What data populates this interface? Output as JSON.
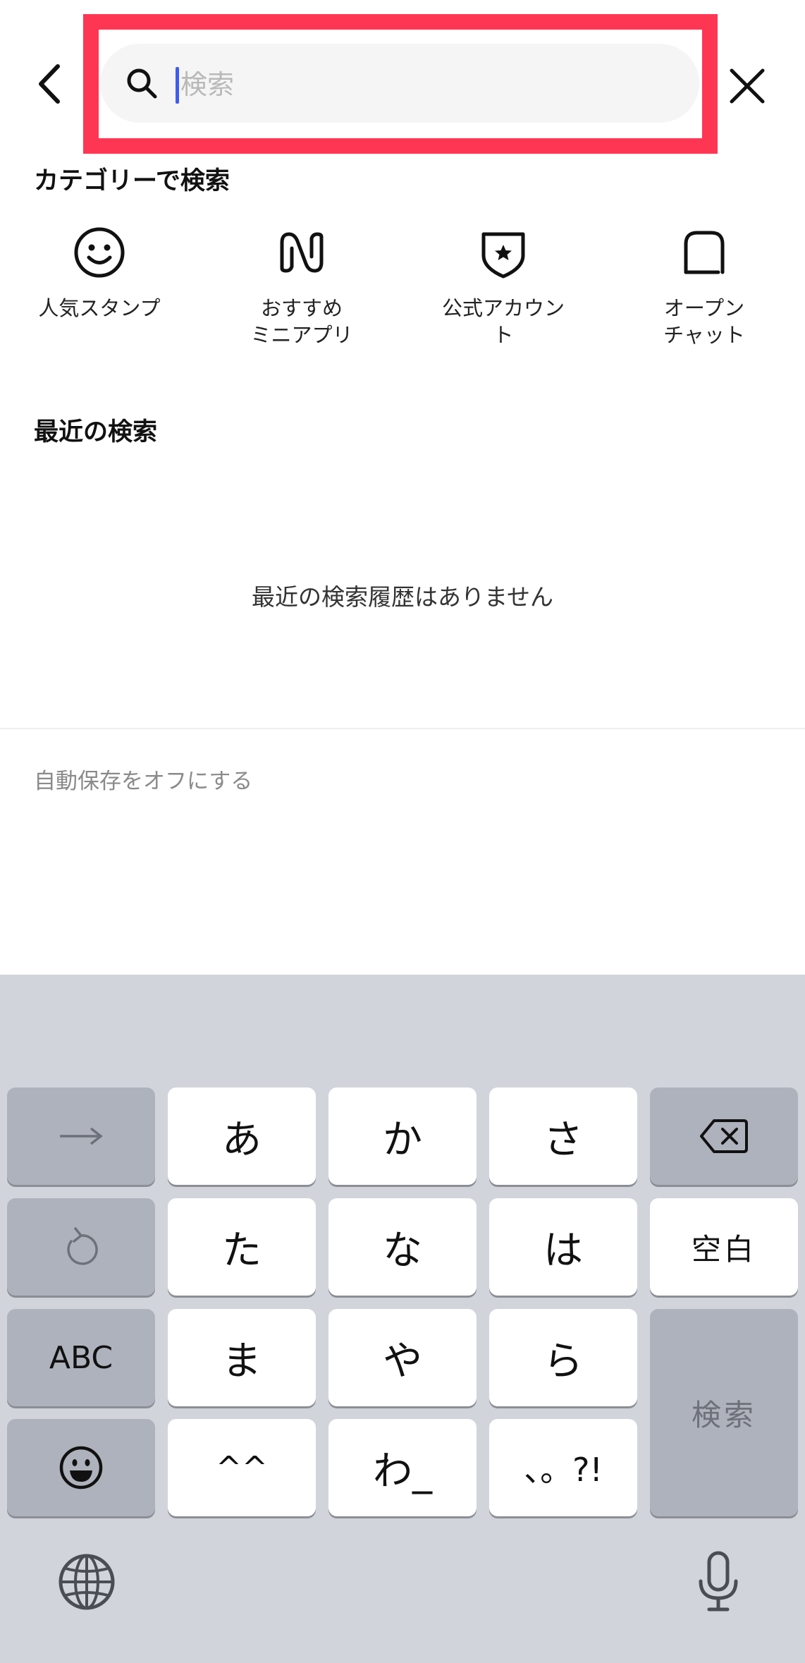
{
  "header": {
    "search_placeholder": "検索"
  },
  "categories": {
    "title": "カテゴリーで検索",
    "items": [
      {
        "label": "人気スタンプ",
        "icon": "smiley-icon"
      },
      {
        "label": "おすすめ\nミニアプリ",
        "icon": "mini-app-icon"
      },
      {
        "label": "公式アカウン\nト",
        "icon": "official-account-shield-icon"
      },
      {
        "label": "オープン\nチャット",
        "icon": "open-chat-icon"
      }
    ]
  },
  "recent": {
    "title": "最近の検索",
    "empty_message": "最近の検索履歴はありません",
    "autosave_off": "自動保存をオフにする"
  },
  "keyboard": {
    "row1": [
      "→",
      "あ",
      "か",
      "さ",
      "⌫"
    ],
    "row2": [
      "↺",
      "た",
      "な",
      "は",
      "空白"
    ],
    "row3": [
      "ABC",
      "ま",
      "や",
      "ら",
      "検索"
    ],
    "row4": [
      "☺",
      "^^",
      "わ_",
      "、。?!"
    ]
  },
  "colors": {
    "highlight": "#ff3653",
    "caret": "#3f5cf0",
    "keyboard_bg": "#d1d4db",
    "dark_key": "#aeb2bc"
  }
}
